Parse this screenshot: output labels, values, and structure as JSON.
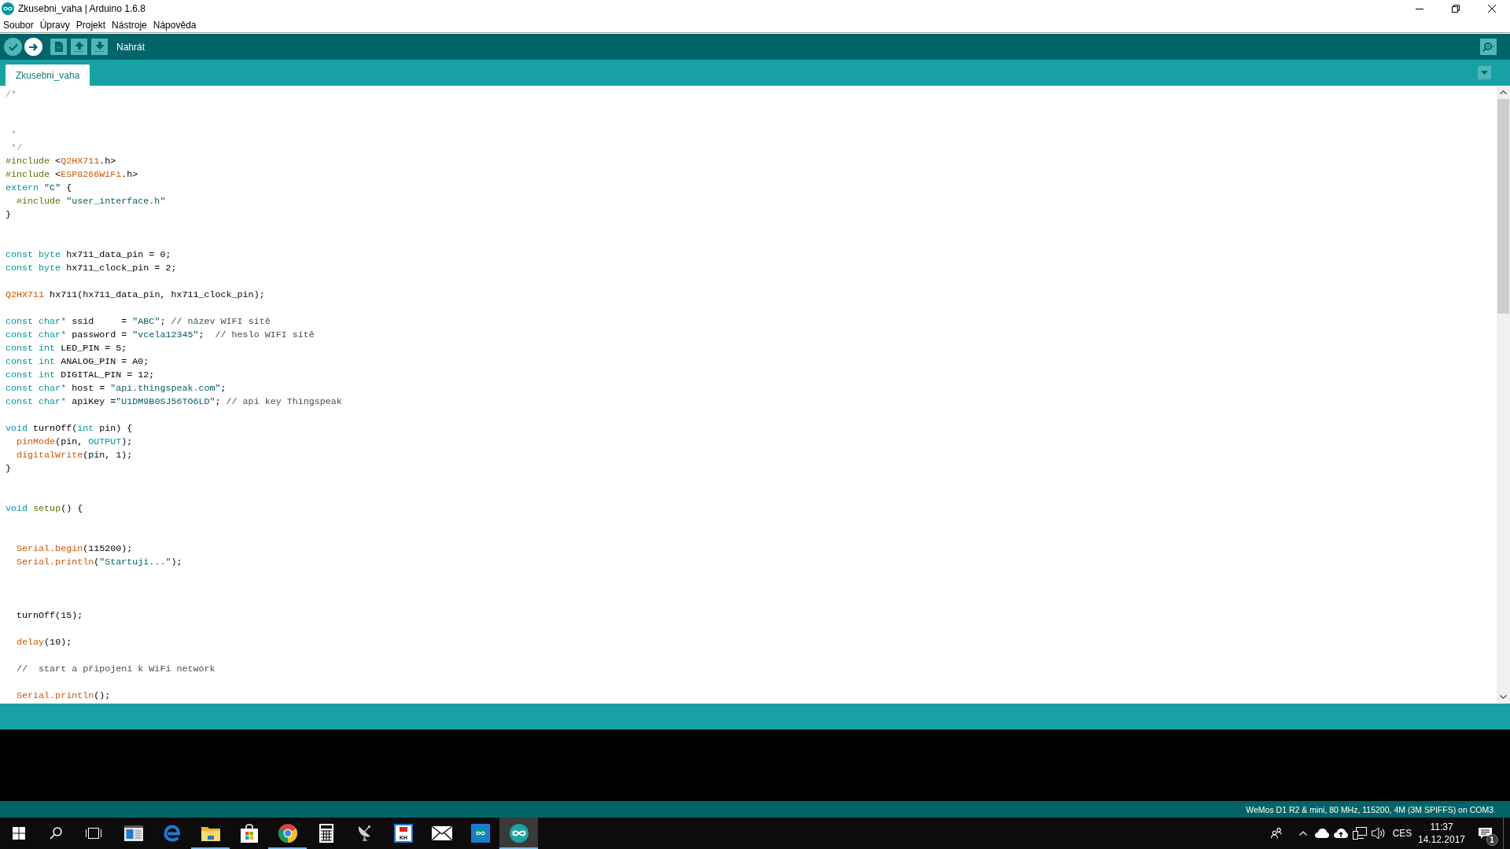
{
  "window": {
    "title": "Zkusebni_vaha | Arduino 1.6.8"
  },
  "menu": [
    "Soubor",
    "Úpravy",
    "Projekt",
    "Nástroje",
    "Nápověda"
  ],
  "toolbar": {
    "buttons": [
      {
        "hovered": false
      },
      {
        "hovered": true
      },
      {
        "hovered": false
      },
      {
        "hovered": false
      },
      {
        "hovered": false
      }
    ],
    "hover_label": "Nahrát"
  },
  "tabs": [
    {
      "label": "Zkusebni_vaha",
      "selected": true
    }
  ],
  "editor": {
    "lines": [
      {
        "kind": "code",
        "tokens": [
          {
            "kind": "block_comment",
            "text": "/*"
          }
        ]
      },
      {
        "kind": "blank"
      },
      {
        "kind": "blank"
      },
      {
        "kind": "code",
        "tokens": [
          {
            "kind": "block_comment",
            "text": " *"
          }
        ]
      },
      {
        "kind": "code",
        "tokens": [
          {
            "kind": "block_comment",
            "text": " */"
          }
        ]
      },
      {
        "kind": "code",
        "tokens": [
          {
            "kind": "preprocessor",
            "text": "#include"
          },
          {
            "kind": "plain",
            "text": " <"
          },
          {
            "kind": "library",
            "text": "Q2HX711"
          },
          {
            "kind": "plain",
            "text": ".h>"
          }
        ]
      },
      {
        "kind": "code",
        "tokens": [
          {
            "kind": "preprocessor",
            "text": "#include"
          },
          {
            "kind": "plain",
            "text": " <"
          },
          {
            "kind": "library",
            "text": "ESP8266WiFi"
          },
          {
            "kind": "plain",
            "text": ".h>"
          }
        ]
      },
      {
        "kind": "code",
        "tokens": [
          {
            "kind": "keyword",
            "text": "extern "
          },
          {
            "kind": "string",
            "text": "\"C\""
          },
          {
            "kind": "plain",
            "text": " {"
          }
        ]
      },
      {
        "kind": "code",
        "tokens": [
          {
            "kind": "preprocessor",
            "text": "  #include "
          },
          {
            "kind": "string",
            "text": "\"user_interface.h\""
          }
        ]
      },
      {
        "kind": "code",
        "tokens": [
          {
            "kind": "plain",
            "text": "}"
          }
        ]
      },
      {
        "kind": "blank"
      },
      {
        "kind": "blank"
      },
      {
        "kind": "code",
        "tokens": [
          {
            "kind": "keyword",
            "text": "const byte"
          },
          {
            "kind": "plain",
            "text": " hx711_data_pin = 0;"
          }
        ]
      },
      {
        "kind": "code",
        "tokens": [
          {
            "kind": "keyword",
            "text": "const byte"
          },
          {
            "kind": "plain",
            "text": " hx711_clock_pin = 2;"
          }
        ]
      },
      {
        "kind": "blank"
      },
      {
        "kind": "code",
        "tokens": [
          {
            "kind": "library",
            "text": "Q2HX711"
          },
          {
            "kind": "plain",
            "text": " hx711(hx711_data_pin, hx711_clock_pin);"
          }
        ]
      },
      {
        "kind": "blank"
      },
      {
        "kind": "code",
        "tokens": [
          {
            "kind": "keyword",
            "text": "const char*"
          },
          {
            "kind": "plain",
            "text": " ssid     = "
          },
          {
            "kind": "string",
            "text": "\"ABC\""
          },
          {
            "kind": "plain",
            "text": "; "
          },
          {
            "kind": "comment",
            "text": "// název WIFI sítě"
          }
        ]
      },
      {
        "kind": "code",
        "tokens": [
          {
            "kind": "keyword",
            "text": "const char*"
          },
          {
            "kind": "plain",
            "text": " password = "
          },
          {
            "kind": "string",
            "text": "\"vcela12345\""
          },
          {
            "kind": "plain",
            "text": ";  "
          },
          {
            "kind": "comment",
            "text": "// heslo WIFI sítě"
          }
        ]
      },
      {
        "kind": "code",
        "tokens": [
          {
            "kind": "keyword",
            "text": "const int"
          },
          {
            "kind": "plain",
            "text": " LED_PIN = 5;"
          }
        ]
      },
      {
        "kind": "code",
        "tokens": [
          {
            "kind": "keyword",
            "text": "const int"
          },
          {
            "kind": "plain",
            "text": " ANALOG_PIN = A0;"
          }
        ]
      },
      {
        "kind": "code",
        "tokens": [
          {
            "kind": "keyword",
            "text": "const int"
          },
          {
            "kind": "plain",
            "text": " DIGITAL_PIN = 12;"
          }
        ]
      },
      {
        "kind": "code",
        "tokens": [
          {
            "kind": "keyword",
            "text": "const char*"
          },
          {
            "kind": "plain",
            "text": " host = "
          },
          {
            "kind": "string",
            "text": "\"api.thingspeak.com\""
          },
          {
            "kind": "plain",
            "text": ";"
          }
        ]
      },
      {
        "kind": "code",
        "tokens": [
          {
            "kind": "keyword",
            "text": "const char*"
          },
          {
            "kind": "plain",
            "text": " apiKey ="
          },
          {
            "kind": "string",
            "text": "\"U1DM9B0SJ56TO6LD\""
          },
          {
            "kind": "plain",
            "text": "; "
          },
          {
            "kind": "comment",
            "text": "// api key Thingspeak"
          }
        ]
      },
      {
        "kind": "blank"
      },
      {
        "kind": "code",
        "tokens": [
          {
            "kind": "keyword",
            "text": "void"
          },
          {
            "kind": "plain",
            "text": " turnOff("
          },
          {
            "kind": "keyword",
            "text": "int"
          },
          {
            "kind": "plain",
            "text": " pin) {"
          }
        ]
      },
      {
        "kind": "code",
        "tokens": [
          {
            "kind": "function",
            "text": "  pinMode"
          },
          {
            "kind": "plain",
            "text": "(pin, "
          },
          {
            "kind": "keyword",
            "text": "OUTPUT"
          },
          {
            "kind": "plain",
            "text": ");"
          }
        ]
      },
      {
        "kind": "code",
        "tokens": [
          {
            "kind": "function",
            "text": "  digitalWrite"
          },
          {
            "kind": "plain",
            "text": "(pin, 1);"
          }
        ]
      },
      {
        "kind": "code",
        "tokens": [
          {
            "kind": "plain",
            "text": "}"
          }
        ]
      },
      {
        "kind": "blank"
      },
      {
        "kind": "blank"
      },
      {
        "kind": "code",
        "tokens": [
          {
            "kind": "keyword",
            "text": "void "
          },
          {
            "kind": "structure",
            "text": "setup"
          },
          {
            "kind": "plain",
            "text": "() {"
          }
        ]
      },
      {
        "kind": "blank"
      },
      {
        "kind": "blank"
      },
      {
        "kind": "code",
        "tokens": [
          {
            "kind": "function",
            "text": "  Serial.begin"
          },
          {
            "kind": "plain",
            "text": "(115200);"
          }
        ]
      },
      {
        "kind": "code",
        "tokens": [
          {
            "kind": "function",
            "text": "  Serial.println"
          },
          {
            "kind": "plain",
            "text": "("
          },
          {
            "kind": "string",
            "text": "\"Startuji...\""
          },
          {
            "kind": "plain",
            "text": ");"
          }
        ]
      },
      {
        "kind": "blank"
      },
      {
        "kind": "blank"
      },
      {
        "kind": "blank"
      },
      {
        "kind": "code",
        "tokens": [
          {
            "kind": "plain",
            "text": "  turnOff(15);"
          }
        ]
      },
      {
        "kind": "blank"
      },
      {
        "kind": "code",
        "tokens": [
          {
            "kind": "function",
            "text": "  delay"
          },
          {
            "kind": "plain",
            "text": "(10);"
          }
        ]
      },
      {
        "kind": "blank"
      },
      {
        "kind": "code",
        "tokens": [
          {
            "kind": "comment",
            "text": "  //  start a připojení k WiFi network"
          }
        ]
      },
      {
        "kind": "blank"
      },
      {
        "kind": "code",
        "tokens": [
          {
            "kind": "function",
            "text": "  Serial.println"
          },
          {
            "kind": "plain",
            "text": "();"
          }
        ]
      }
    ]
  },
  "board_status": "WeMos D1 R2 & mini, 80 MHz, 115200, 4M (3M SPIFFS) on COM3",
  "taskbar": {
    "apps": [
      {
        "running": false,
        "selected": false
      },
      {
        "running": false,
        "selected": false
      },
      {
        "running": true,
        "selected": false
      },
      {
        "running": false,
        "selected": false
      },
      {
        "running": true,
        "selected": false
      },
      {
        "running": false,
        "selected": false
      },
      {
        "running": false,
        "selected": false
      },
      {
        "running": false,
        "selected": false,
        "text": "KH"
      },
      {
        "running": false,
        "selected": false
      },
      {
        "running": false,
        "selected": false
      },
      {
        "running": true,
        "selected": true
      }
    ],
    "language": "CES",
    "time": "11:37",
    "date": "14.12.2017",
    "notification_count": "1"
  }
}
